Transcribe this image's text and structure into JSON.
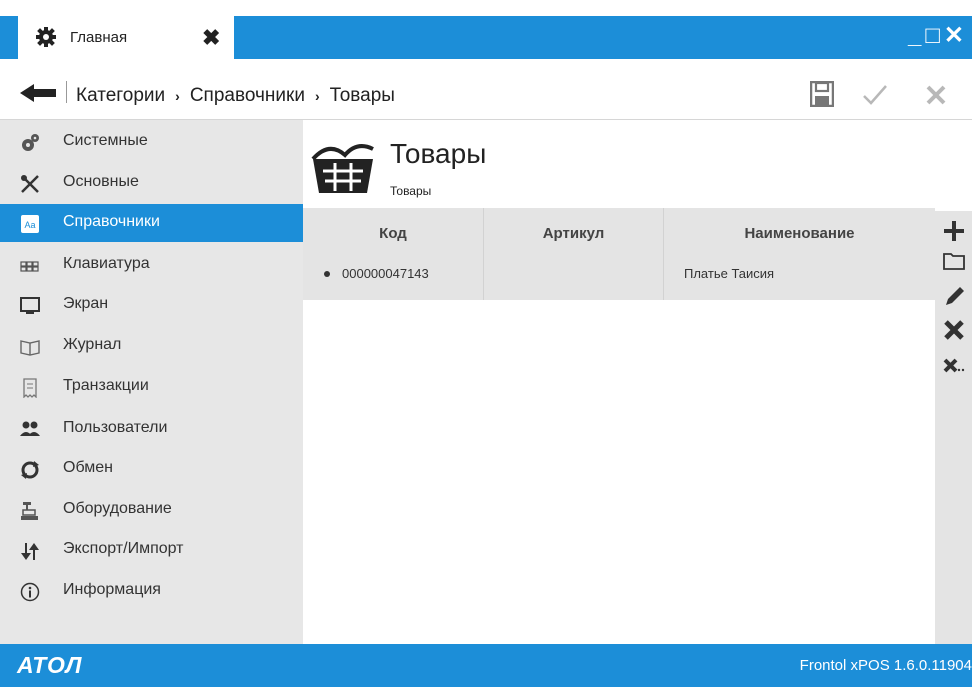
{
  "tab": {
    "label": "Главная",
    "icon": "gear-icon"
  },
  "window_controls": {
    "minimize": "_",
    "maximize": "□",
    "close": "✕"
  },
  "breadcrumb": {
    "items": [
      "Категории",
      "Справочники",
      "Товары"
    ],
    "separator": "›"
  },
  "toolbar": {
    "save_icon": "save-icon",
    "apply_icon": "check-icon",
    "cancel_icon": "close-icon"
  },
  "sidebar": {
    "items": [
      {
        "label": "Системные",
        "icon": "gears-icon"
      },
      {
        "label": "Основные",
        "icon": "tools-icon"
      },
      {
        "label": "Справочники",
        "icon": "dictionary-icon",
        "active": true
      },
      {
        "label": "Клавиатура",
        "icon": "keyboard-icon"
      },
      {
        "label": "Экран",
        "icon": "monitor-icon"
      },
      {
        "label": "Журнал",
        "icon": "journal-icon"
      },
      {
        "label": "Транзакции",
        "icon": "receipt-icon"
      },
      {
        "label": "Пользователи",
        "icon": "users-icon"
      },
      {
        "label": "Обмен",
        "icon": "sync-icon"
      },
      {
        "label": "Оборудование",
        "icon": "cash-register-icon"
      },
      {
        "label": "Экспорт/Импорт",
        "icon": "export-import-icon"
      },
      {
        "label": "Информация",
        "icon": "info-icon"
      }
    ]
  },
  "content": {
    "title": "Товары",
    "subtitle": "Товары",
    "icon": "basket-icon",
    "table": {
      "columns": [
        "Код",
        "Артикул",
        "Наименование"
      ],
      "rows": [
        {
          "code": "000000047143",
          "article": "",
          "name": "Платье Таисия"
        }
      ]
    }
  },
  "right_toolbar": [
    "add-icon",
    "folder-icon",
    "edit-icon",
    "delete-icon",
    "delete-all-icon"
  ],
  "footer": {
    "logo": "АТОЛ",
    "version": "Frontol xPOS 1.6.0.11904"
  },
  "colors": {
    "accent": "#1c8ed8",
    "sidebar_bg": "#e7e7e7",
    "grid_bg": "#e4e4e4"
  }
}
